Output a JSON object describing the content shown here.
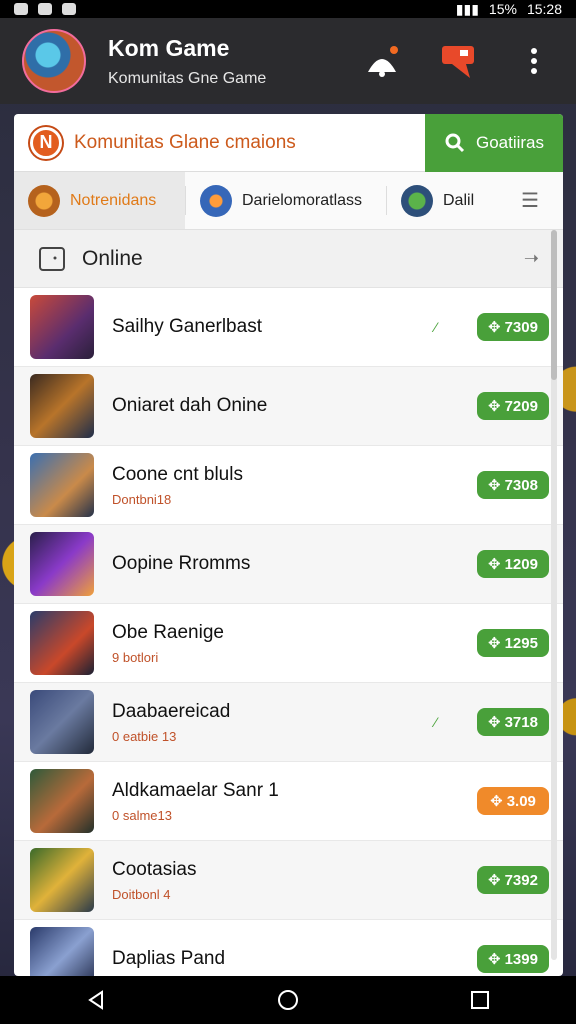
{
  "status_bar": {
    "battery": "15%",
    "time": "15:28"
  },
  "header": {
    "title": "Kom Game",
    "subtitle": "Komunitas Gne Game"
  },
  "search": {
    "placeholder": "Komunitas Glane cmaions",
    "button_label": "Goatiiras",
    "badge_letter": "N"
  },
  "tabs": [
    {
      "label": "Notrenidans"
    },
    {
      "label": "Darielomoratlass"
    },
    {
      "label": "Dalil"
    }
  ],
  "section": {
    "title": "Online"
  },
  "items": [
    {
      "title": "Sailhy Ganerlbast",
      "subtitle": "",
      "price": "7309",
      "checked": true,
      "price_color": "green"
    },
    {
      "title": "Oniaret dah Onine",
      "subtitle": "",
      "price": "7209",
      "checked": false,
      "price_color": "green"
    },
    {
      "title": "Coone cnt bluls",
      "subtitle": "Dontbni18",
      "price": "7308",
      "checked": false,
      "price_color": "green"
    },
    {
      "title": "Oopine Rromms",
      "subtitle": "",
      "price": "1209",
      "checked": false,
      "price_color": "green"
    },
    {
      "title": "Obe Raenige",
      "subtitle": "9 botlori",
      "price": "1295",
      "checked": false,
      "price_color": "green"
    },
    {
      "title": "Daabaereicad",
      "subtitle": "0 eatbie 13",
      "price": "3718",
      "checked": true,
      "price_color": "green"
    },
    {
      "title": "Aldkamaelar Sanr 1",
      "subtitle": "0 salme13",
      "price": "3.09",
      "checked": false,
      "price_color": "orange"
    },
    {
      "title": "Cootasias",
      "subtitle": "Doitbonl 4",
      "price": "7392",
      "checked": false,
      "price_color": "green"
    },
    {
      "title": "Daplias Pand",
      "subtitle": "",
      "price": "1399",
      "checked": false,
      "price_color": "green"
    }
  ],
  "colors": {
    "accent_green": "#49a03a",
    "accent_orange": "#e07a18"
  }
}
